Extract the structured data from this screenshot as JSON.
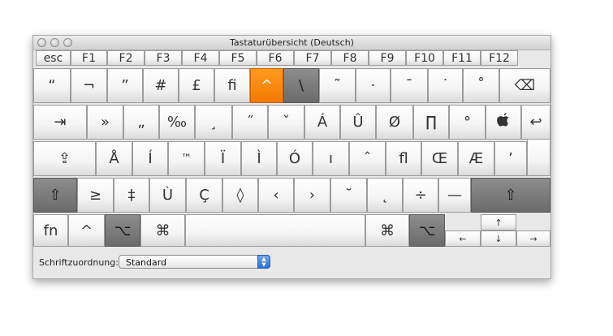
{
  "window": {
    "title": "Tastaturübersicht (Deutsch)"
  },
  "fn_row": [
    "esc",
    "F1",
    "F2",
    "F3",
    "F4",
    "F5",
    "F6",
    "F7",
    "F8",
    "F9",
    "F10",
    "F11",
    "F12"
  ],
  "row1": [
    "“",
    "¬",
    "”",
    "#",
    "£",
    "fi",
    "^",
    "\\",
    "˜",
    "·",
    "¯",
    "˙",
    "˚",
    "⌫"
  ],
  "row2": [
    "⇥",
    "»",
    "„",
    "‰",
    "¸",
    "˝",
    "ˇ",
    "Á",
    "Û",
    "Ø",
    "∏",
    "°",
    "",
    "↩"
  ],
  "row3": [
    "⇪",
    "Å",
    "Í",
    "™",
    "Ï",
    "Ì",
    "Ó",
    "ı",
    "ˆ",
    "ﬂ",
    "Œ",
    "Æ",
    "’"
  ],
  "row4": [
    "⇧",
    "≥",
    "‡",
    "Ù",
    "Ç",
    "◊",
    "‹",
    "›",
    "˘",
    "˛",
    "÷",
    "—",
    "⇧"
  ],
  "row5": [
    "fn",
    "^",
    "⌥",
    "⌘",
    "",
    "⌘",
    "⌥"
  ],
  "arrows": {
    "up": "↑",
    "left": "←",
    "down": "↓",
    "right": "→"
  },
  "footer": {
    "label": "Schriftzuordnung:",
    "select_value": "Standard"
  },
  "colors": {
    "highlight": "#f47a00",
    "modifier_active": "#6f6f6f"
  },
  "state": {
    "highlighted_key": "^",
    "active_modifiers": [
      "left-option",
      "right-option"
    ]
  }
}
